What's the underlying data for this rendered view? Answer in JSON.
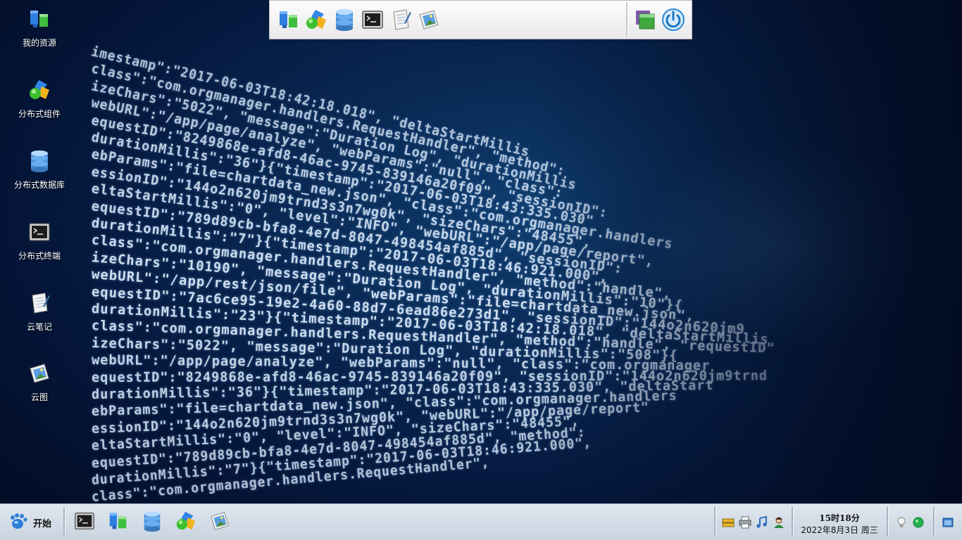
{
  "wallpaper": {
    "lines": [
      "imestamp\":\"2017-06-03T18:42:18.018\", \"deltaStartMillis",
      "class\":\"com.orgmanager.handlers.RequestHandler\", \"method\":",
      "izeChars\":\"5022\", \"message\":\"Duration Log\", \"durationMillis",
      "webURL\":\"/app/page/analyze\", \"webParams\":\"null\", \"class\":",
      "equestID\":\"8249868e-afd8-46ac-9745-839146a20f09\", \"sessionID\":",
      "durationMillis\":\"36\"}{\"timestamp\":\"2017-06-03T18:43:335.030\"",
      "ebParams\":\"file=chartdata_new.json\", \"class\":\"com.orgmanager.handlers",
      "essionID\":\"144o2n620jm9trnd3s3n7wg0k\", \"sizeChars\":\"48455\",",
      "eltaStartMillis\":\"0\", \"level\":\"INFO\", \"webURL\":\"/app/page/report\",",
      "equestID\":\"789d89cb-bfa8-4e7d-8047-498454af885d\", \"sessionID\":",
      "durationMillis\":\"7\"}{\"timestamp\":\"2017-06-03T18:46:921.000\",",
      "class\":\"com.orgmanager.handlers.RequestHandler\", \"method\":\"handle\",",
      "izeChars\":\"10190\", \"message\":\"Duration Log\", \"durationMillis\":\"10\"}{",
      "webURL\":\"/app/rest/json/file\", \"webParams\":\"file=chartdata_new.json\",",
      "equestID\":\"7ac6ce95-19e2-4a60-88d7-6ead86e273d1\", \"sessionID\":\"144o2n620jm9",
      "durationMillis\":\"23\"}{\"timestamp\":\"2017-06-03T18:42:18.018\", \"deltaStartMillis",
      "class\":\"com.orgmanager.handlers.RequestHandler\", \"method\":\"handle\", \"requestID\"",
      "izeChars\":\"5022\", \"message\":\"Duration Log\", \"durationMillis\":\"508\"}{",
      "webURL\":\"/app/page/analyze\", \"webParams\":\"null\", \"class\":\"com.orgmanager",
      "equestID\":\"8249868e-afd8-46ac-9745-839146a20f09\", \"sessionID\":\"144o2n620jm9trnd",
      "durationMillis\":\"36\"}{\"timestamp\":\"2017-06-03T18:43:335.030\", \"deltaStart",
      "ebParams\":\"file=chartdata_new.json\", \"class\":\"com.orgmanager.handlers",
      "essionID\":\"144o2n620jm9trnd3s3n7wg0k\", \"webURL\":\"/app/page/report\"",
      "eltaStartMillis\":\"0\", \"level\":\"INFO\", \"sizeChars\":\"48455\",",
      "equestID\":\"789d89cb-bfa8-4e7d-8047-498454af885d\", \"method\":",
      "durationMillis\":\"7\"}{\"timestamp\":\"2017-06-03T18:46:921.000\",",
      "class\":\"com.orgmanager.handlers.RequestHandler\","
    ]
  },
  "desktop": {
    "icons": [
      {
        "label": "我的资源",
        "icon": "resources-icon"
      },
      {
        "label": "分布式组件",
        "icon": "components-icon"
      },
      {
        "label": "分布式数据库",
        "icon": "database-icon"
      },
      {
        "label": "分布式终端",
        "icon": "terminal-icon"
      },
      {
        "label": "云笔记",
        "icon": "notes-icon"
      },
      {
        "label": "云图",
        "icon": "images-icon"
      }
    ]
  },
  "top_dock": {
    "items": [
      "resources-icon",
      "components-icon",
      "database-icon",
      "terminal-icon",
      "notes-icon",
      "images-icon",
      "windows-icon",
      "power-icon"
    ]
  },
  "taskbar": {
    "start_label": "开始",
    "pinned": [
      "terminal-icon",
      "resources-icon",
      "database-icon",
      "components-icon",
      "images-icon"
    ],
    "tray": [
      "storage-icon",
      "printer-icon",
      "music-icon",
      "user-icon"
    ],
    "clock_time": "15时18分",
    "clock_date": "2022年8月3日  周三",
    "status": [
      "bulb-icon",
      "online-icon"
    ],
    "show_desktop": "show-desktop-icon",
    "colors": {
      "online": "#22b14c"
    }
  }
}
